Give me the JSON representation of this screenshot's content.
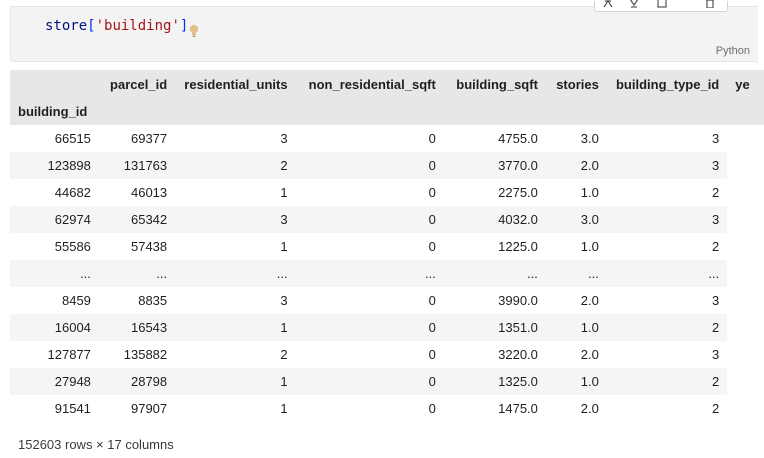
{
  "cell": {
    "code_var": "store",
    "code_open": "[",
    "code_str": "'building'",
    "code_close": "]",
    "language": "Python"
  },
  "table": {
    "columns": [
      "parcel_id",
      "residential_units",
      "non_residential_sqft",
      "building_sqft",
      "stories",
      "building_type_id",
      "ye"
    ],
    "index_name": "building_id",
    "rows": [
      [
        "66515",
        "69377",
        "3",
        "0",
        "4755.0",
        "3.0",
        "3"
      ],
      [
        "123898",
        "131763",
        "2",
        "0",
        "3770.0",
        "2.0",
        "3"
      ],
      [
        "44682",
        "46013",
        "1",
        "0",
        "2275.0",
        "1.0",
        "2"
      ],
      [
        "62974",
        "65342",
        "3",
        "0",
        "4032.0",
        "3.0",
        "3"
      ],
      [
        "55586",
        "57438",
        "1",
        "0",
        "1225.0",
        "1.0",
        "2"
      ],
      [
        "...",
        "...",
        "...",
        "...",
        "...",
        "...",
        "..."
      ],
      [
        "8459",
        "8835",
        "3",
        "0",
        "3990.0",
        "2.0",
        "3"
      ],
      [
        "16004",
        "16543",
        "1",
        "0",
        "1351.0",
        "1.0",
        "2"
      ],
      [
        "127877",
        "135882",
        "2",
        "0",
        "3220.0",
        "2.0",
        "3"
      ],
      [
        "27948",
        "28798",
        "1",
        "0",
        "1325.0",
        "1.0",
        "2"
      ],
      [
        "91541",
        "97907",
        "1",
        "0",
        "1475.0",
        "2.0",
        "2"
      ]
    ]
  },
  "footer": {
    "shape": "152603 rows × 17 columns"
  },
  "icons": {
    "bulb": "lightbulb-icon",
    "toolbar": [
      "execute-above-icon",
      "execute-below-icon",
      "split-cell-icon",
      "delete-icon"
    ],
    "bulb_color": "#e2c08d"
  }
}
